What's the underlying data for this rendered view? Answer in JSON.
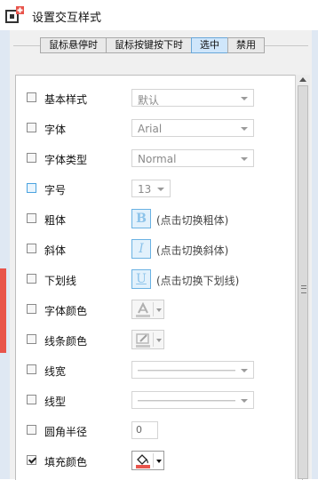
{
  "window": {
    "title": "设置交互样式"
  },
  "tabs": [
    {
      "label": "鼠标悬停时",
      "active": false
    },
    {
      "label": "鼠标按键按下时",
      "active": false
    },
    {
      "label": "选中",
      "active": true
    },
    {
      "label": "禁用",
      "active": false
    }
  ],
  "rows": {
    "base_style": {
      "label": "基本样式",
      "value": "默认"
    },
    "font": {
      "label": "字体",
      "value": "Arial"
    },
    "font_type": {
      "label": "字体类型",
      "value": "Normal"
    },
    "font_size": {
      "label": "字号",
      "value": "13"
    },
    "bold": {
      "label": "粗体",
      "glyph": "B",
      "hint": "(点击切换粗体)"
    },
    "italic": {
      "label": "斜体",
      "glyph": "I",
      "hint": "(点击切换斜体)"
    },
    "underline": {
      "label": "下划线",
      "glyph": "U",
      "hint": "(点击切换下划线)"
    },
    "font_color": {
      "label": "字体颜色"
    },
    "line_color": {
      "label": "线条颜色"
    },
    "line_width": {
      "label": "线宽"
    },
    "line_type": {
      "label": "线型"
    },
    "corner_radius": {
      "label": "圆角半径",
      "value": "0"
    },
    "fill_color": {
      "label": "填充颜色",
      "checked": true
    }
  },
  "colors": {
    "accent": "#4aa3df",
    "tab_active": "#cfe6fb",
    "fill_swatch": "#e8544b"
  },
  "icons": {
    "app": "app-logo-icon",
    "font_color": "font-color-icon",
    "line_color": "pencil-line-color-icon",
    "fill_color": "paint-bucket-icon",
    "scroll_up": "scroll-up-arrow-icon",
    "dropdown": "chevron-down-icon"
  }
}
